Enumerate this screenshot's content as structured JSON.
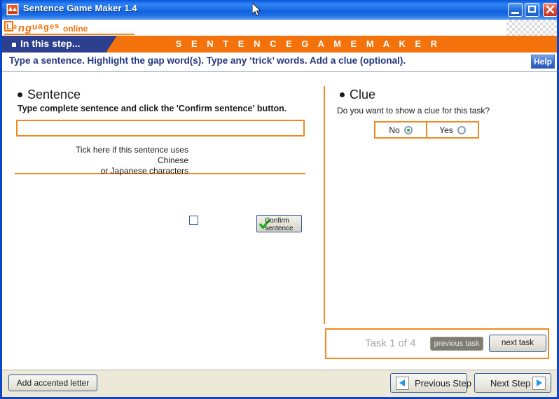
{
  "window": {
    "title": "Sentence Game Maker 1.4",
    "app_icon": "app-mountain-icon",
    "minimize_label": "Minimize",
    "maximize_label": "Maximize",
    "close_label": "Close",
    "accent_color": "#f4720b",
    "title_bar_color": "#1c6fe4",
    "tab_color": "#2d3f8f"
  },
  "branding": {
    "logo_text": "Languages online",
    "band_title": "S E N T E N C E   G A M E   M A K E R"
  },
  "step": {
    "tab_label": "In this step...",
    "instruction": "Type a sentence. Highlight the gap word(s). Type any ‘trick’ words.  Add a clue (optional).",
    "help_label": "Help"
  },
  "sentence_panel": {
    "heading": "Sentence",
    "subheading": "Type complete sentence and click the 'Confirm sentence' button.",
    "input_value": "",
    "input_placeholder": "",
    "chinese_checkbox_label": "Tick here if this sentence uses Chinese or Japanese characters",
    "chinese_checkbox_checked": false,
    "confirm_button_label": "Confirm sentence"
  },
  "clue_panel": {
    "heading": "Clue",
    "question": "Do you want to show a clue for this task?",
    "options": [
      {
        "label": "No",
        "selected": true
      },
      {
        "label": "Yes",
        "selected": false
      }
    ]
  },
  "task_nav": {
    "counter": "Task 1 of 4",
    "previous_label": "previous task",
    "previous_disabled": true,
    "next_label": "next task",
    "next_disabled": false
  },
  "toolbar": {
    "accent_label": "Add accented letter",
    "previous_step_label": "Previous Step",
    "next_step_label": "Next Step"
  }
}
